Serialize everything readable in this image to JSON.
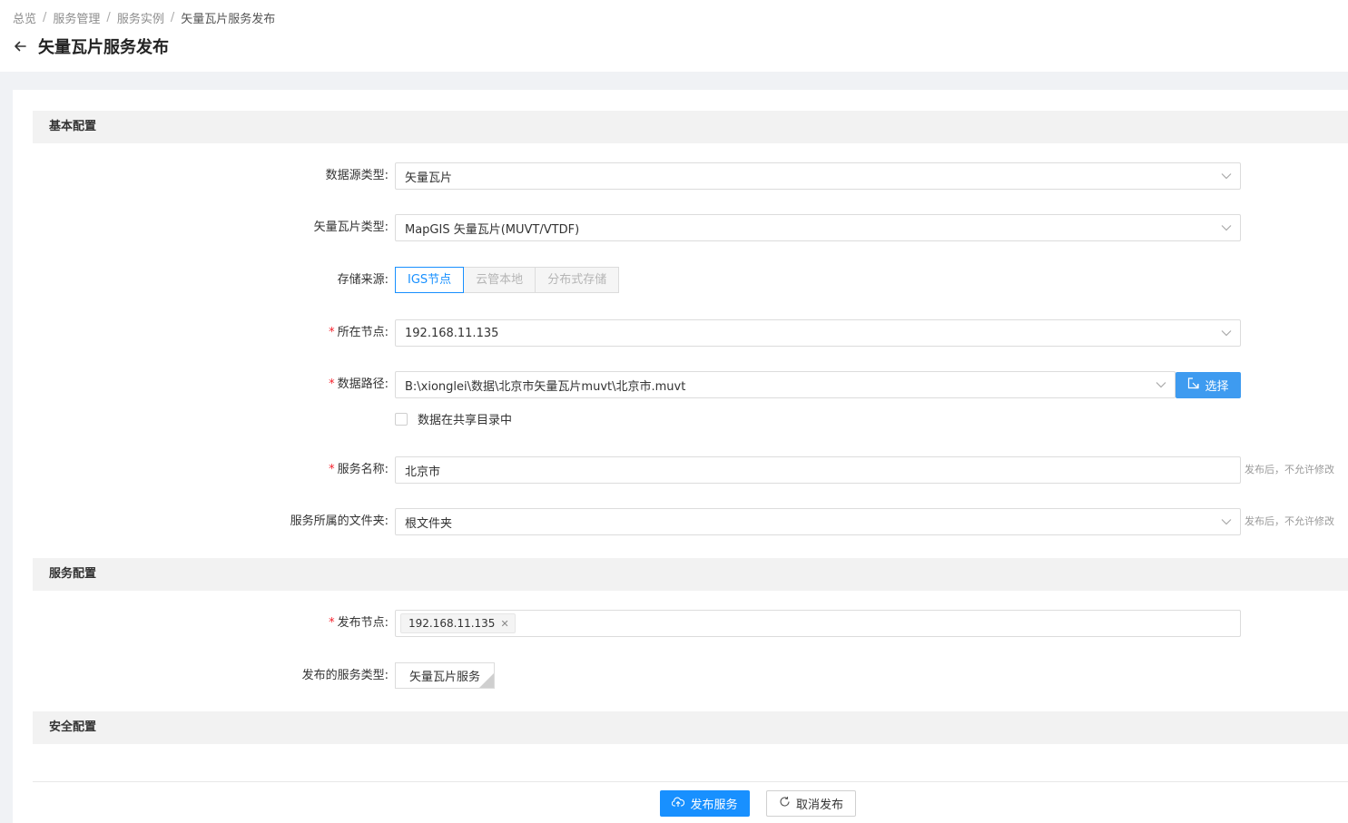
{
  "breadcrumb": [
    "总览",
    "服务管理",
    "服务实例",
    "矢量瓦片服务发布"
  ],
  "page": {
    "title": "矢量瓦片服务发布"
  },
  "sections": {
    "basic": "基本配置",
    "service": "服务配置",
    "security": "安全配置"
  },
  "form": {
    "datasource_type": {
      "label": "数据源类型:",
      "value": "矢量瓦片"
    },
    "tile_type": {
      "label": "矢量瓦片类型:",
      "value": "MapGIS 矢量瓦片(MUVT/VTDF)"
    },
    "storage": {
      "label": "存储来源:",
      "options": [
        "IGS节点",
        "云管本地",
        "分布式存储"
      ],
      "selected": "IGS节点"
    },
    "node": {
      "label": "所在节点:",
      "value": "192.168.11.135"
    },
    "data_path": {
      "label": "数据路径:",
      "value": "B:\\xionglei\\数据\\北京市矢量瓦片muvt\\北京市.muvt",
      "select_button": "选择"
    },
    "shared_dir": {
      "label": "数据在共享目录中",
      "checked": false
    },
    "service_name": {
      "label": "服务名称:",
      "value": "北京市",
      "hint": "发布后，不允许修改"
    },
    "folder": {
      "label": "服务所属的文件夹:",
      "value": "根文件夹",
      "hint": "发布后，不允许修改"
    },
    "publish_node": {
      "label": "发布节点:",
      "tags": [
        "192.168.11.135"
      ]
    },
    "publish_type": {
      "label": "发布的服务类型:",
      "value": "矢量瓦片服务"
    }
  },
  "footer": {
    "publish": "发布服务",
    "cancel": "取消发布"
  },
  "colors": {
    "primary": "#1890ff",
    "required": "#f5222d",
    "select_btn": "#3e9bf0"
  }
}
